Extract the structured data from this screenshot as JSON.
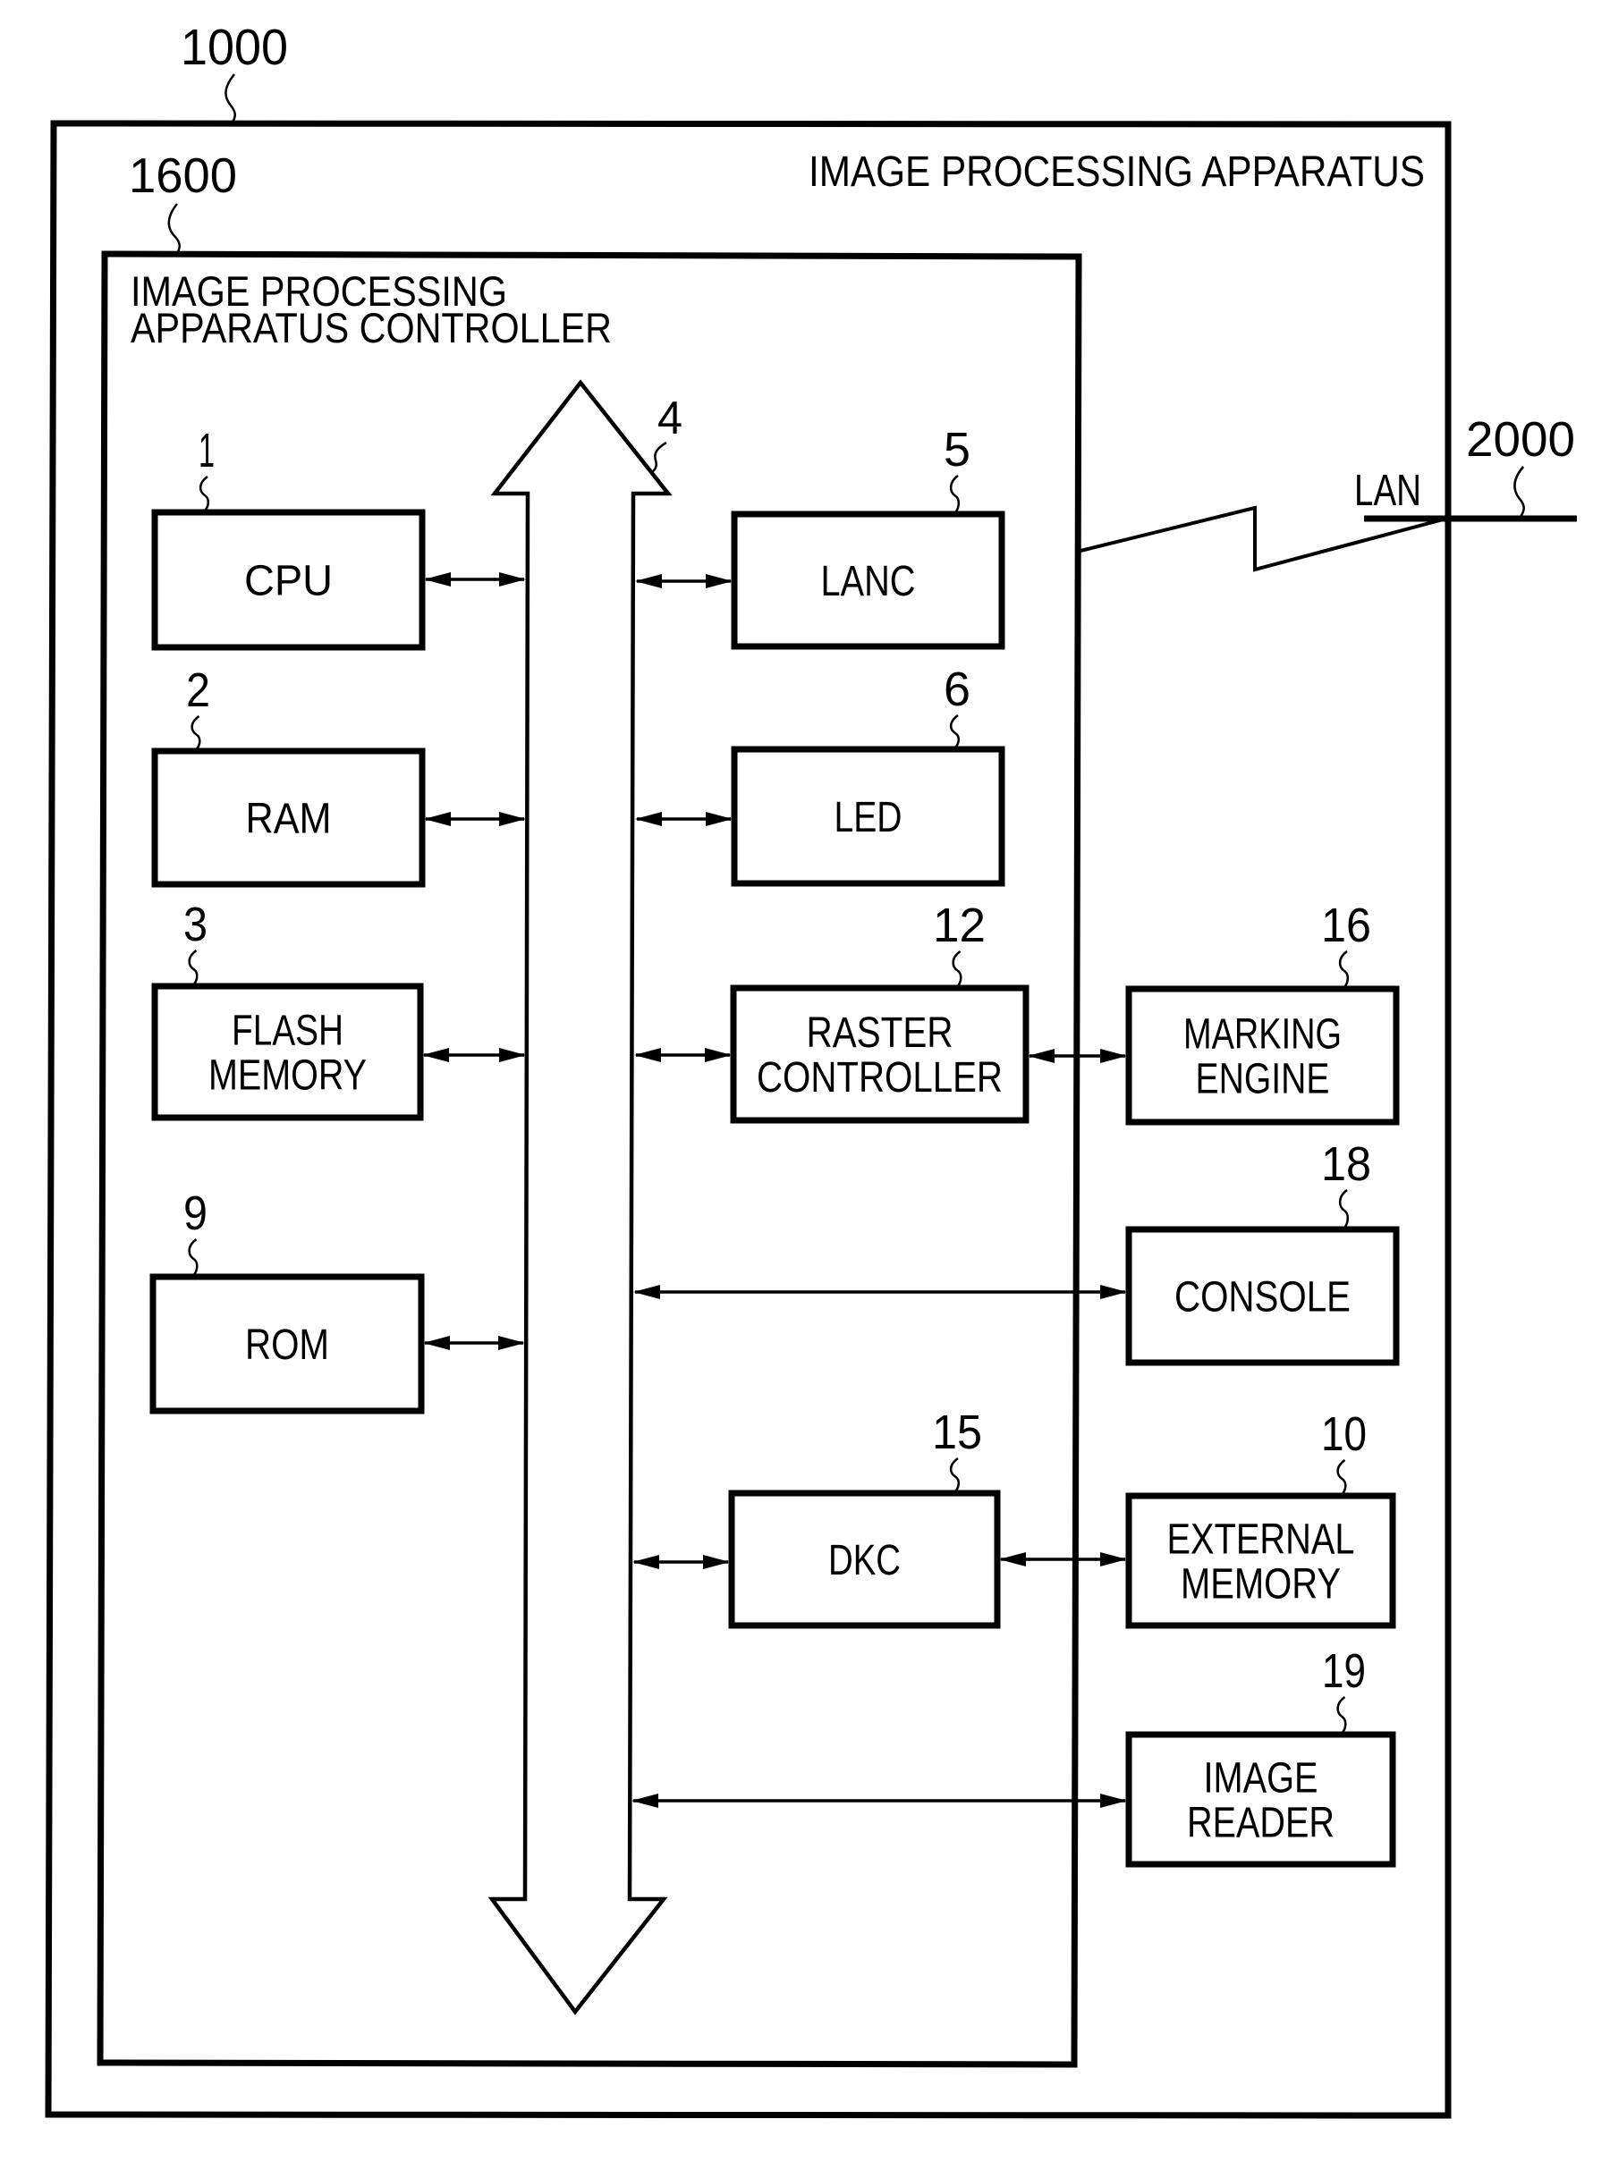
{
  "figure": {
    "apparatus": {
      "ref": "1000",
      "title": "IMAGE PROCESSING APPARATUS"
    },
    "controller": {
      "ref": "1600",
      "title_lines": [
        "IMAGE PROCESSING",
        "APPARATUS CONTROLLER"
      ]
    },
    "bus": {
      "ref": "4"
    },
    "network": {
      "ref": "2000",
      "label": "LAN"
    },
    "blocks": [
      {
        "id": "cpu",
        "ref": "1",
        "lines": [
          "CPU"
        ]
      },
      {
        "id": "ram",
        "ref": "2",
        "lines": [
          "RAM"
        ]
      },
      {
        "id": "flash-memory",
        "ref": "3",
        "lines": [
          "FLASH",
          "MEMORY"
        ]
      },
      {
        "id": "rom",
        "ref": "9",
        "lines": [
          "ROM"
        ]
      },
      {
        "id": "lanc",
        "ref": "5",
        "lines": [
          "LANC"
        ]
      },
      {
        "id": "led",
        "ref": "6",
        "lines": [
          "LED"
        ]
      },
      {
        "id": "raster-controller",
        "ref": "12",
        "lines": [
          "RASTER",
          "CONTROLLER"
        ]
      },
      {
        "id": "dkc",
        "ref": "15",
        "lines": [
          "DKC"
        ]
      },
      {
        "id": "marking-engine",
        "ref": "16",
        "lines": [
          "MARKING",
          "ENGINE"
        ]
      },
      {
        "id": "console",
        "ref": "18",
        "lines": [
          "CONSOLE"
        ]
      },
      {
        "id": "external-memory",
        "ref": "10",
        "lines": [
          "EXTERNAL",
          "MEMORY"
        ]
      },
      {
        "id": "image-reader",
        "ref": "19",
        "lines": [
          "IMAGE",
          "READER"
        ]
      }
    ],
    "connections": [
      {
        "from": "cpu",
        "to": "bus",
        "type": "bidirectional"
      },
      {
        "from": "ram",
        "to": "bus",
        "type": "bidirectional"
      },
      {
        "from": "flash-memory",
        "to": "bus",
        "type": "bidirectional"
      },
      {
        "from": "rom",
        "to": "bus",
        "type": "bidirectional"
      },
      {
        "from": "bus",
        "to": "lanc",
        "type": "bidirectional"
      },
      {
        "from": "bus",
        "to": "led",
        "type": "bidirectional"
      },
      {
        "from": "bus",
        "to": "raster-controller",
        "type": "bidirectional"
      },
      {
        "from": "raster-controller",
        "to": "marking-engine",
        "type": "bidirectional"
      },
      {
        "from": "bus",
        "to": "console",
        "type": "bidirectional"
      },
      {
        "from": "bus",
        "to": "dkc",
        "type": "bidirectional"
      },
      {
        "from": "dkc",
        "to": "external-memory",
        "type": "bidirectional"
      },
      {
        "from": "bus",
        "to": "image-reader",
        "type": "bidirectional"
      },
      {
        "from": "controller",
        "to": "network",
        "type": "network-link"
      }
    ]
  }
}
